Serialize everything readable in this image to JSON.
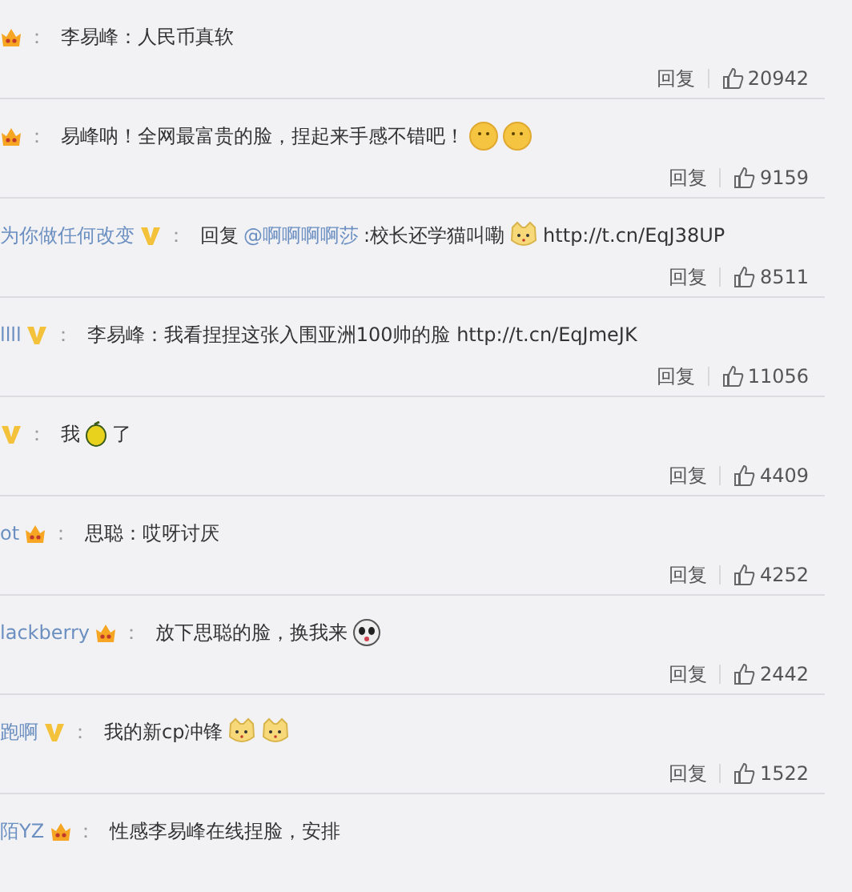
{
  "comments": [
    {
      "badge": {
        "kind": "crown"
      },
      "colon": "：",
      "content": [
        {
          "kind": "text",
          "text": "李易峰：人民币真软"
        }
      ],
      "reply": "回复",
      "likes": "20942"
    },
    {
      "badge": {
        "kind": "crown"
      },
      "colon": "：",
      "content": [
        {
          "kind": "text",
          "text": "易峰呐！全网最富贵的脸，捏起来手感不错吧！"
        },
        {
          "kind": "smile"
        },
        {
          "kind": "smile"
        }
      ],
      "reply": "回复",
      "likes": "9159"
    },
    {
      "user": "为你做任何改变",
      "badge": {
        "kind": "v"
      },
      "colon": "：",
      "content": [
        {
          "kind": "text",
          "text": "回复"
        },
        {
          "kind": "mention",
          "text": "@啊啊啊啊莎"
        },
        {
          "kind": "text",
          "text": ":校长还学猫叫嘞"
        },
        {
          "kind": "cat"
        },
        {
          "kind": "text",
          "text": "http://t.cn/EqJ38UP"
        }
      ],
      "reply": "回复",
      "likes": "8511"
    },
    {
      "user": "llll",
      "badge": {
        "kind": "v"
      },
      "colon": "：",
      "content": [
        {
          "kind": "text",
          "text": "李易峰：我看捏捏这张入围亚洲100帅的脸 http://t.cn/EqJmeJK"
        }
      ],
      "reply": "回复",
      "likes": "11056"
    },
    {
      "badge": {
        "kind": "v"
      },
      "colon": "：",
      "content": [
        {
          "kind": "text",
          "text": "我"
        },
        {
          "kind": "lemon"
        },
        {
          "kind": "text",
          "text": "了"
        }
      ],
      "reply": "回复",
      "likes": "4409"
    },
    {
      "user": "ot",
      "badge": {
        "kind": "crown"
      },
      "colon": "：",
      "content": [
        {
          "kind": "text",
          "text": "思聪：哎呀讨厌"
        }
      ],
      "reply": "回复",
      "likes": "4252"
    },
    {
      "user": "lackberry",
      "badge": {
        "kind": "crown"
      },
      "colon": "：",
      "content": [
        {
          "kind": "text",
          "text": "放下思聪的脸，换我来"
        },
        {
          "kind": "panda"
        }
      ],
      "reply": "回复",
      "likes": "2442"
    },
    {
      "user": "跑啊",
      "badge": {
        "kind": "v"
      },
      "colon": "：",
      "content": [
        {
          "kind": "text",
          "text": "我的新cp冲锋"
        },
        {
          "kind": "cat"
        },
        {
          "kind": "cat"
        }
      ],
      "reply": "回复",
      "likes": "1522"
    },
    {
      "user": "陌YZ",
      "badge": {
        "kind": "crown"
      },
      "colon": "：",
      "content": [
        {
          "kind": "text",
          "text": "性感李易峰在线捏脸，安排"
        }
      ]
    }
  ]
}
